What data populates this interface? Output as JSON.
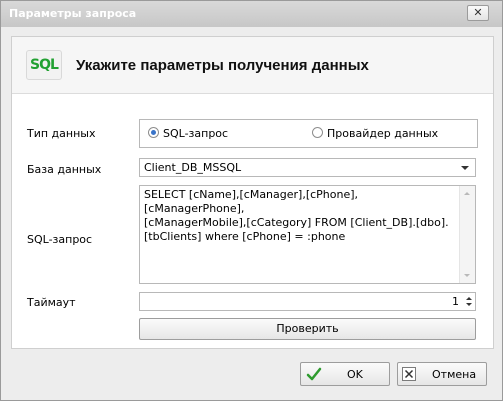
{
  "window": {
    "title": "Параметры запроса",
    "close_glyph": "✕"
  },
  "header": {
    "icon_text": "SQL",
    "title": "Укажите параметры получения данных"
  },
  "data_type": {
    "label": "Тип данных",
    "options": [
      {
        "label": "SQL-запрос",
        "checked": true
      },
      {
        "label": "Провайдер данных",
        "checked": false
      }
    ]
  },
  "database": {
    "label": "База данных",
    "value": "Client_DB_MSSQL"
  },
  "sql": {
    "label": "SQL-запрос",
    "value": "SELECT [cName],[cManager],[cPhone],[cManagerPhone],\n[cManagerMobile],[cCategory] FROM [Client_DB].[dbo].\n[tbClients] where [cPhone] = :phone"
  },
  "timeout": {
    "label": "Таймаут",
    "value": "1"
  },
  "check_button": {
    "label": "Проверить"
  },
  "footer": {
    "ok": {
      "label": "OK",
      "icon": "checkmark-icon"
    },
    "cancel": {
      "label": "Отмена",
      "icon": "close-icon"
    }
  },
  "colors": {
    "accent_green": "#22a132",
    "radio_dot": "#3a74c9"
  }
}
